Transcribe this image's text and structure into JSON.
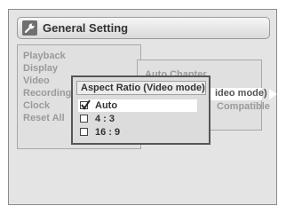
{
  "window": {
    "title": "General Setting",
    "icon": "wrench-icon"
  },
  "left_menu": {
    "items": [
      {
        "label": "Playback"
      },
      {
        "label": "Display"
      },
      {
        "label": "Video"
      },
      {
        "label": "Recording"
      },
      {
        "label": "Clock"
      },
      {
        "label": "Reset All"
      }
    ]
  },
  "right_panel": {
    "items": [
      {
        "label": "Auto Chapter"
      },
      {
        "label": "ideo mode)"
      },
      {
        "label": "Compatible"
      }
    ]
  },
  "popup": {
    "title": "Aspect Ratio (Video mode)",
    "options": [
      {
        "label": "Auto",
        "checked": true
      },
      {
        "label": "4 : 3",
        "checked": false
      },
      {
        "label": "16 : 9",
        "checked": false
      }
    ]
  }
}
